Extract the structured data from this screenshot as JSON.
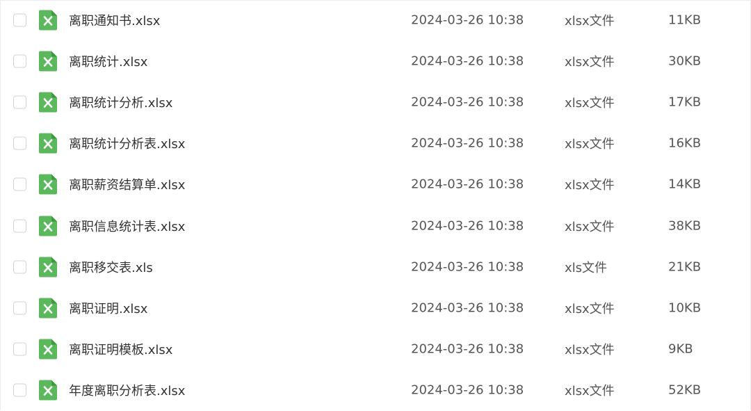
{
  "icons": {
    "file_icon": "excel-file-icon",
    "checkbox": "checkbox-unchecked"
  },
  "colors": {
    "excel_green": "#5cb85c",
    "excel_green_dark": "#3f9a3f",
    "text_primary": "#333333",
    "text_secondary": "#555555",
    "checkbox_border": "#cfd4da"
  },
  "files": [
    {
      "name": "离职通知书.xlsx",
      "date": "2024-03-26 10:38",
      "type": "xlsx文件",
      "size": "11KB"
    },
    {
      "name": "离职统计.xlsx",
      "date": "2024-03-26 10:38",
      "type": "xlsx文件",
      "size": "30KB"
    },
    {
      "name": "离职统计分析.xlsx",
      "date": "2024-03-26 10:38",
      "type": "xlsx文件",
      "size": "17KB"
    },
    {
      "name": "离职统计分析表.xlsx",
      "date": "2024-03-26 10:38",
      "type": "xlsx文件",
      "size": "16KB"
    },
    {
      "name": "离职薪资结算单.xlsx",
      "date": "2024-03-26 10:38",
      "type": "xlsx文件",
      "size": "14KB"
    },
    {
      "name": "离职信息统计表.xlsx",
      "date": "2024-03-26 10:38",
      "type": "xlsx文件",
      "size": "38KB"
    },
    {
      "name": "离职移交表.xls",
      "date": "2024-03-26 10:38",
      "type": "xls文件",
      "size": "21KB"
    },
    {
      "name": "离职证明.xlsx",
      "date": "2024-03-26 10:38",
      "type": "xlsx文件",
      "size": "10KB"
    },
    {
      "name": "离职证明模板.xlsx",
      "date": "2024-03-26 10:38",
      "type": "xlsx文件",
      "size": "9KB"
    },
    {
      "name": "年度离职分析表.xlsx",
      "date": "2024-03-26 10:38",
      "type": "xlsx文件",
      "size": "52KB"
    }
  ]
}
